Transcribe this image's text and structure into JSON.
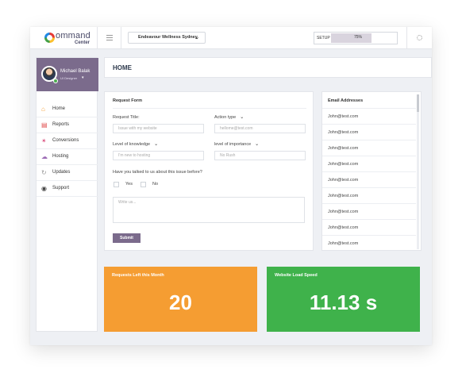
{
  "topbar": {
    "logo_main": "ommand",
    "logo_sub": "Center",
    "site_selector": "Endeavour Wellness Sydney",
    "setup_label": "SETUP",
    "setup_percent": "75%",
    "setup_progress": 0.75
  },
  "profile": {
    "name": "Michael Balak",
    "role": "UI Designer"
  },
  "nav": [
    {
      "label": "Home",
      "icon": "home-icon",
      "color": "#f59d32"
    },
    {
      "label": "Reports",
      "icon": "report-icon",
      "color": "#e05050"
    },
    {
      "label": "Conversions",
      "icon": "conversions-icon",
      "color": "#d94a7a"
    },
    {
      "label": "Hosting",
      "icon": "cloud-icon",
      "color": "#9c6bb5"
    },
    {
      "label": "Updates",
      "icon": "refresh-icon",
      "color": "#999999"
    },
    {
      "label": "Support",
      "icon": "support-icon",
      "color": "#444444"
    }
  ],
  "page_title": "HOME",
  "request_form": {
    "title": "Request Form",
    "request_title_label": "Request Title:",
    "request_title_placeholder": "Issue with my website",
    "action_type_label": "Action type",
    "action_type_placeholder": "hellome@test.com",
    "knowledge_label": "Level of knowledge",
    "knowledge_placeholder": "I'm new to hosting",
    "importance_label": "level of importance",
    "importance_placeholder": "No Rush",
    "question": "Have you talked to us about this issue before?",
    "yes_label": "Yes",
    "no_label": "No",
    "message_placeholder": "Write us...",
    "submit_label": "Submit"
  },
  "email_addresses": {
    "title": "Email Addresses",
    "items": [
      "John@test.com",
      "John@test.com",
      "John@test.com",
      "John@test.com",
      "John@test.com",
      "John@test.com",
      "John@test.com",
      "John@test.com",
      "John@test.com"
    ]
  },
  "stats": {
    "requests_label": "Requests Left this Month",
    "requests_value": "20",
    "requests_color": "#f59d32",
    "speed_label": "Website Load Speed",
    "speed_value": "11.13 s",
    "speed_color": "#3fb24b"
  },
  "colors": {
    "accent": "#7b6b8c"
  }
}
